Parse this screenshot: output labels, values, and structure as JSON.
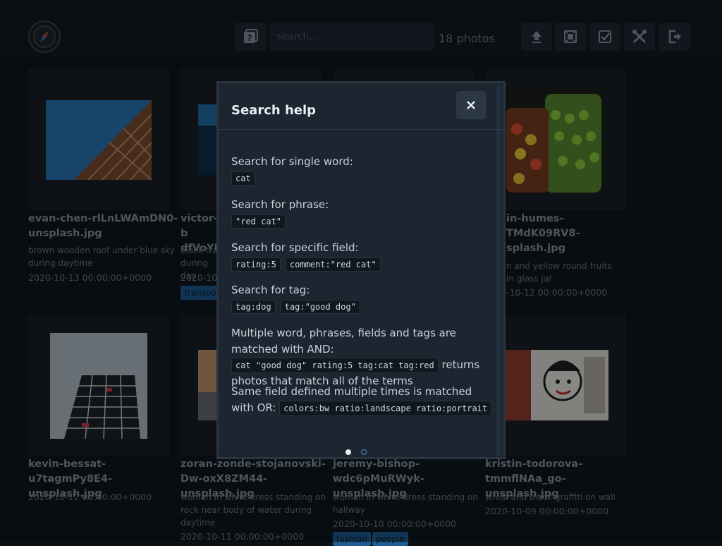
{
  "header": {
    "search_placeholder": "search...",
    "photo_count": "18 photos",
    "icons": [
      "help-box-icon",
      "upload-icon",
      "slideshow-icon",
      "select-checkbox-icon",
      "tools-icon",
      "logout-icon"
    ]
  },
  "photos": [
    {
      "file": "evan-chen-rlLnLWAmDN0-unsplash.jpg",
      "description": "brown wooden roof under blue sky during daytime",
      "date": "2020-10-13 00:00:00+0000",
      "tags": []
    },
    {
      "file": "victor-b dfVoYF",
      "description": "black trat during day",
      "date": "2020-10-",
      "tags": [
        "transpo"
      ]
    },
    {
      "file": "in-humes- TMdK09RV8- splash.jpg",
      "description": "n and yellow round fruits in glass jar",
      "date": "-10-12 00:00:00+0000",
      "tags": []
    },
    {
      "file": "kevin-bessat-u7tagmPy8E4-unsplash.jpg",
      "description": "",
      "date": "2020-10-12 00:00:00+0000",
      "tags": []
    },
    {
      "file": "zoran-zonde-stojanovski-Dw-oxX8ZM44-unsplash.jpg",
      "description": "woman in white dress standing on rock near body of water during daytime",
      "date": "2020-10-11 00:00:00+0000",
      "tags": []
    },
    {
      "file": "jeremy-bishop-wdc6pMuRWyk-unsplash.jpg",
      "description": "woman in white dress standing on hallway",
      "date": "2020-10-10 00:00:00+0000",
      "tags": [
        "fashion",
        "people"
      ]
    },
    {
      "file": "kristin-todorova-tmmflNAa_go-unsplash.jpg",
      "description": "white and black graffiti on wall",
      "date": "2020-10-09 00:00:00+0000",
      "tags": []
    }
  ],
  "modal": {
    "title": "Search help",
    "close_icon": "close-icon",
    "single_word_label": "Search for single word:",
    "single_word_code": "cat",
    "phrase_label": "Search for phrase:",
    "phrase_code": "\"red cat\"",
    "field_label": "Search for specific field:",
    "field_code_1": "rating:5",
    "field_code_2": "comment:\"red cat\"",
    "tag_label": "Search for tag:",
    "tag_code_1": "tag:dog",
    "tag_code_2": "tag:\"good dog\"",
    "and_text_1": "Multiple word, phrases, fields and tags are matched with AND:",
    "and_code": "cat \"good dog\" rating:5 tag:cat tag:red",
    "and_text_2": "returns photos that match all of the terms",
    "or_text_1": "Same field defined multiple times is matched with OR:",
    "or_code": "colors:bw ratio:landscape ratio:portrait",
    "pages": 2,
    "active_page": 1
  }
}
